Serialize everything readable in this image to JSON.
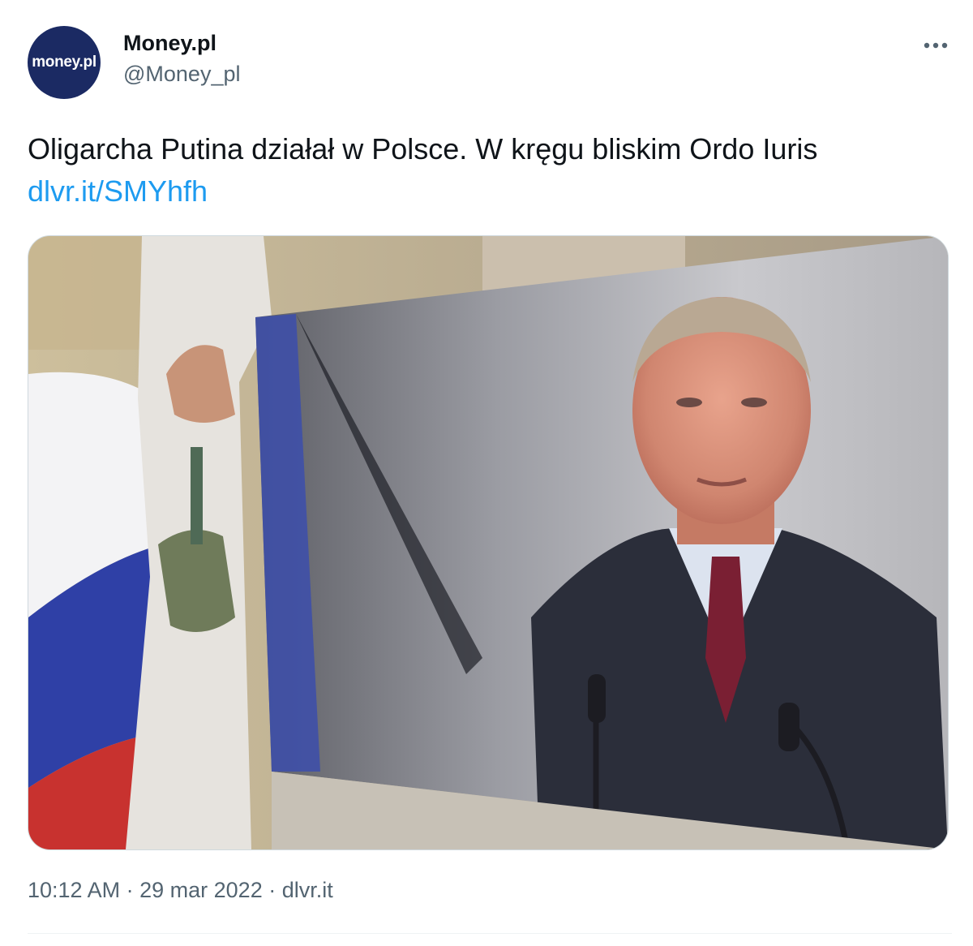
{
  "tweet": {
    "avatar_text": "money",
    "avatar_text_suffix": ".pl",
    "author_name": "Money.pl",
    "author_handle": "@Money_pl",
    "text": "Oligarcha Putina działał w Polsce. W kręgu bliskim Ordo Iuris",
    "link_text": "dlvr.it/SMYhfh",
    "time": "10:12 AM",
    "date": "29 mar 2022",
    "source": "dlvr.it",
    "separator": "·",
    "more_icon": "more-horizontal-icon"
  },
  "colors": {
    "link": "#1d9bf0",
    "secondary_text": "#536471",
    "avatar_bg": "#1b2a63"
  }
}
